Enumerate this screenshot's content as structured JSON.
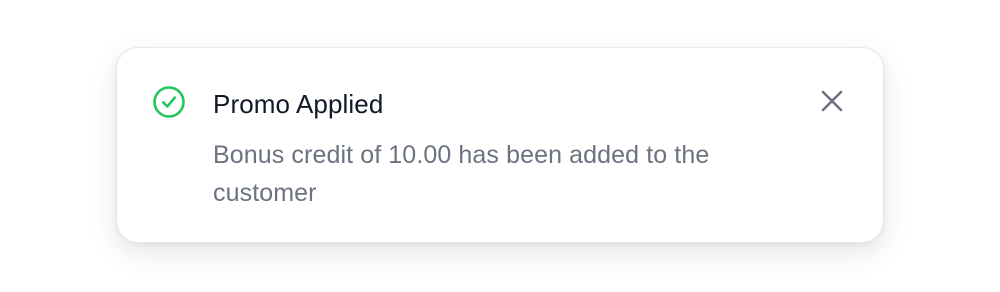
{
  "toast": {
    "title": "Promo Applied",
    "message": "Bonus credit of 10.00 has been added to the customer",
    "status_icon": "check-circle-icon",
    "close_icon": "close-icon",
    "close_label": "Close"
  },
  "colors": {
    "success": "#22c55e",
    "title": "#111827",
    "message": "#6b7280",
    "close_icon": "#6b7280",
    "border": "#e6e7ea"
  }
}
